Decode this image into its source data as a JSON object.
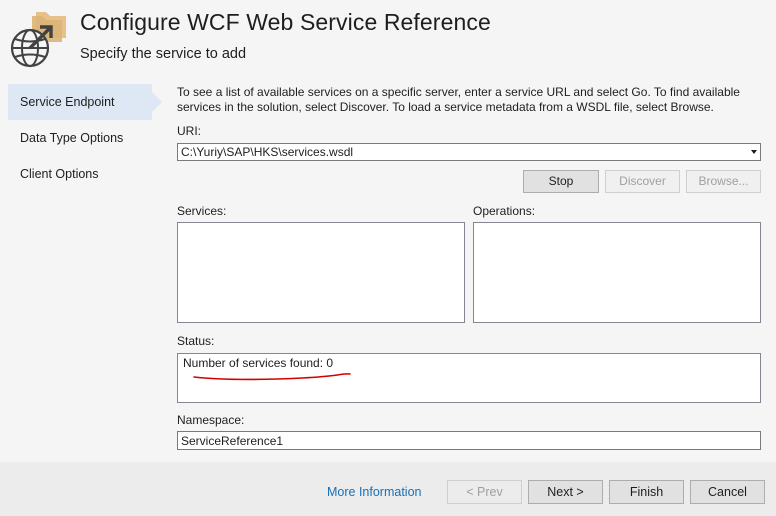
{
  "header": {
    "title": "Configure WCF Web Service Reference",
    "subtitle": "Specify the service to add",
    "icon": "wcf-service-globe-icon"
  },
  "sidebar": {
    "items": [
      {
        "label": "Service Endpoint",
        "active": true
      },
      {
        "label": "Data Type Options",
        "active": false
      },
      {
        "label": "Client Options",
        "active": false
      }
    ]
  },
  "main": {
    "description": "To see a list of available services on a specific server, enter a service URL and select Go. To find available services in the solution, select Discover.  To load a service metadata from a WSDL file, select Browse.",
    "uri_label": "URI:",
    "uri_value": "C:\\Yuriy\\SAP\\HKS\\services.wsdl",
    "buttons": {
      "stop": "Stop",
      "discover": "Discover",
      "browse": "Browse..."
    },
    "services_label": "Services:",
    "operations_label": "Operations:",
    "status_label": "Status:",
    "status_text": "Number of services found: 0",
    "namespace_label": "Namespace:",
    "namespace_value": "ServiceReference1"
  },
  "footer": {
    "more_info": "More Information",
    "prev": "< Prev",
    "next": "Next >",
    "finish": "Finish",
    "cancel": "Cancel"
  },
  "colors": {
    "accent": "#dde8f4",
    "link": "#1a6fb5",
    "annotation": "#d40000",
    "logo_folder": "#e8c089"
  }
}
